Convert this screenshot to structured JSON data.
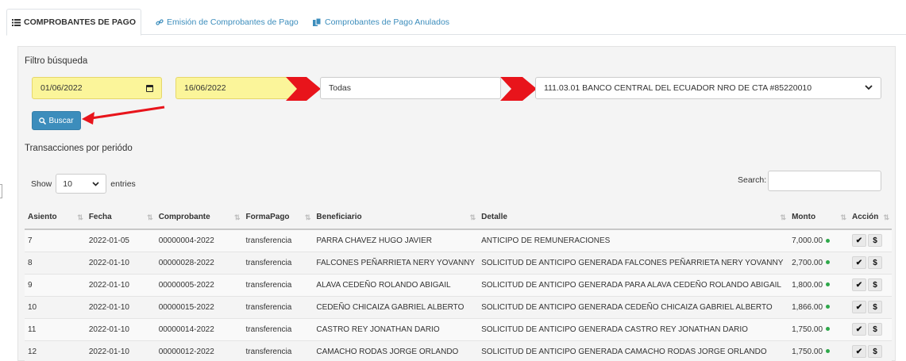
{
  "tabs": [
    {
      "label": "COMPROBANTES DE PAGO",
      "icon": "list-icon",
      "active": true
    },
    {
      "label": "Emisión de Comprobantes de Pago",
      "icon": "link-icon",
      "active": false
    },
    {
      "label": "Comprobantes de Pago Anulados",
      "icon": "copy-icon",
      "active": false
    }
  ],
  "filter": {
    "title": "Filtro búsqueda",
    "date_from": "01/06/2022",
    "date_to": "16/06/2022",
    "type_select": "Todas",
    "account_select": "111.03.01 BANCO CENTRAL DEL ECUADOR NRO DE CTA #85220010",
    "search_button": "Buscar",
    "annotation_color": "#e8141b"
  },
  "transactions": {
    "title": "Transacciones por periódo",
    "show_label": "Show",
    "entries_value": "10",
    "entries_label": "entries",
    "search_label": "Search:",
    "columns": [
      "Asiento",
      "Fecha",
      "Comprobante",
      "FormaPago",
      "Beneficiario",
      "Detalle",
      "Monto",
      "Acción"
    ],
    "rows": [
      {
        "asiento": "7",
        "fecha": "2022-01-05",
        "comprobante": "00000004-2022",
        "forma": "transferencia",
        "beneficiario": "PARRA CHAVEZ HUGO JAVIER",
        "detalle": "ANTICIPO DE REMUNERACIONES",
        "monto": "7,000.00"
      },
      {
        "asiento": "8",
        "fecha": "2022-01-10",
        "comprobante": "00000028-2022",
        "forma": "transferencia",
        "beneficiario": "FALCONES PEÑARRIETA NERY YOVANNY",
        "detalle": "SOLICITUD DE ANTICIPO GENERADA FALCONES PEÑARRIETA NERY YOVANNY",
        "monto": "2,700.00"
      },
      {
        "asiento": "9",
        "fecha": "2022-01-10",
        "comprobante": "00000005-2022",
        "forma": "transferencia",
        "beneficiario": "ALAVA CEDEÑO ROLANDO ABIGAIL",
        "detalle": "SOLICITUD DE ANTICIPO GENERADA PARA ALAVA CEDEÑO ROLANDO ABIGAIL",
        "monto": "1,800.00"
      },
      {
        "asiento": "10",
        "fecha": "2022-01-10",
        "comprobante": "00000015-2022",
        "forma": "transferencia",
        "beneficiario": "CEDEÑO CHICAIZA GABRIEL ALBERTO",
        "detalle": "SOLICITUD DE ANTICIPO GENERADA CEDEÑO CHICAIZA GABRIEL ALBERTO",
        "monto": "1,866.00"
      },
      {
        "asiento": "11",
        "fecha": "2022-01-10",
        "comprobante": "00000014-2022",
        "forma": "transferencia",
        "beneficiario": "CASTRO REY JONATHAN DARIO",
        "detalle": "SOLICITUD DE ANTICIPO GENERADA CASTRO REY JONATHAN DARIO",
        "monto": "1,750.00"
      },
      {
        "asiento": "12",
        "fecha": "2022-01-10",
        "comprobante": "00000012-2022",
        "forma": "transferencia",
        "beneficiario": "CAMACHO RODAS JORGE ORLANDO",
        "detalle": "SOLICITUD DE ANTICIPO GENERADA CAMACHO RODAS JORGE ORLANDO",
        "monto": "1,750.00"
      }
    ],
    "action_icons": [
      "check-icon",
      "dollar-icon"
    ],
    "accent_color": "#3c8dbc",
    "status_color": "#2ea84a"
  }
}
